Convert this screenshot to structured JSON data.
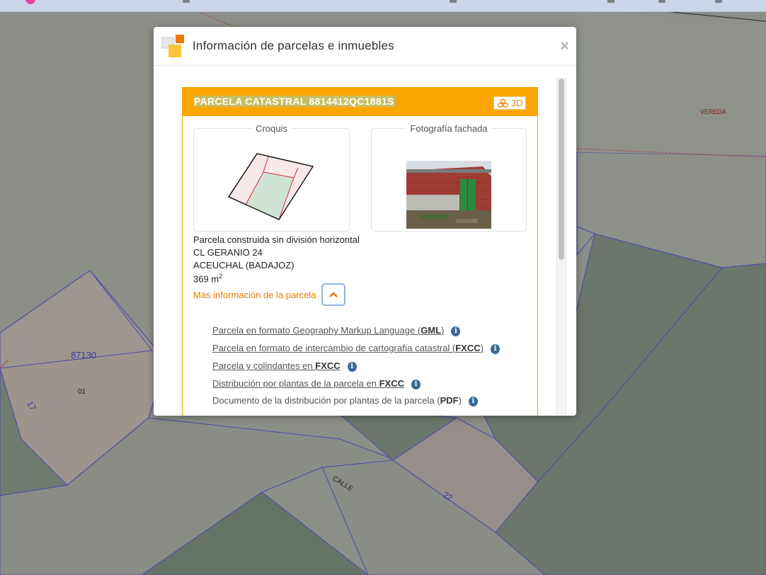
{
  "map": {
    "labels": {
      "vereda": "VEREDA",
      "parcel_id": "87130",
      "parcel_num": "01",
      "calle": "CALLE",
      "num_17": "17",
      "num_22": "22"
    }
  },
  "dialog": {
    "title": "Información de parcelas e inmuebles",
    "close_symbol": "×"
  },
  "parcel": {
    "header_title": "PARCELA CATASTRAL 8814412QC1881S",
    "btn_3d_label": "3D",
    "croquis_label": "Croquis",
    "fachada_label": "Fotografía fachada",
    "type": "Parcela construida sin división horizontal",
    "address": "CL GERANIO 24",
    "locality": "ACEUCHAL (BADAJOZ)",
    "area_value": "369 m",
    "area_unit_sup": "2",
    "more_info": "Más información de la parcela"
  },
  "links": [
    {
      "pre": "Parcela en formato Geography Markup Language (",
      "bold": "GML",
      "post": ")",
      "underlined": true
    },
    {
      "pre": "Parcela en formato de intercambio de cartografía catastral (",
      "bold": "FXCC",
      "post": ")",
      "underlined": true
    },
    {
      "pre": "Parcela y colindantes en ",
      "bold": "FXCC",
      "post": "",
      "underlined": true
    },
    {
      "pre": "Distribución por plantas de la parcela en ",
      "bold": "FXCC",
      "post": "",
      "underlined": true
    },
    {
      "pre": "Documento de la distribución por plantas de la parcela (",
      "bold": "PDF",
      "post": ")",
      "underlined": false
    }
  ],
  "info_icon_char": "i",
  "colors": {
    "header_orange": "#fba600",
    "link_orange": "#e87c00",
    "info_blue": "#3a6a96"
  }
}
